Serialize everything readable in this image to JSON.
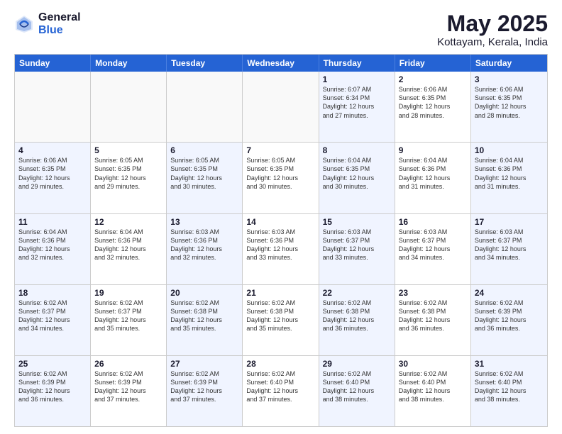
{
  "logo": {
    "general": "General",
    "blue": "Blue"
  },
  "title": "May 2025",
  "location": "Kottayam, Kerala, India",
  "days_of_week": [
    "Sunday",
    "Monday",
    "Tuesday",
    "Wednesday",
    "Thursday",
    "Friday",
    "Saturday"
  ],
  "weeks": [
    [
      {
        "day": "",
        "text": "",
        "empty": true
      },
      {
        "day": "",
        "text": "",
        "empty": true
      },
      {
        "day": "",
        "text": "",
        "empty": true
      },
      {
        "day": "",
        "text": "",
        "empty": true
      },
      {
        "day": "1",
        "text": "Sunrise: 6:07 AM\nSunset: 6:34 PM\nDaylight: 12 hours\nand 27 minutes.",
        "empty": false
      },
      {
        "day": "2",
        "text": "Sunrise: 6:06 AM\nSunset: 6:35 PM\nDaylight: 12 hours\nand 28 minutes.",
        "empty": false
      },
      {
        "day": "3",
        "text": "Sunrise: 6:06 AM\nSunset: 6:35 PM\nDaylight: 12 hours\nand 28 minutes.",
        "empty": false
      }
    ],
    [
      {
        "day": "4",
        "text": "Sunrise: 6:06 AM\nSunset: 6:35 PM\nDaylight: 12 hours\nand 29 minutes.",
        "empty": false
      },
      {
        "day": "5",
        "text": "Sunrise: 6:05 AM\nSunset: 6:35 PM\nDaylight: 12 hours\nand 29 minutes.",
        "empty": false
      },
      {
        "day": "6",
        "text": "Sunrise: 6:05 AM\nSunset: 6:35 PM\nDaylight: 12 hours\nand 30 minutes.",
        "empty": false
      },
      {
        "day": "7",
        "text": "Sunrise: 6:05 AM\nSunset: 6:35 PM\nDaylight: 12 hours\nand 30 minutes.",
        "empty": false
      },
      {
        "day": "8",
        "text": "Sunrise: 6:04 AM\nSunset: 6:35 PM\nDaylight: 12 hours\nand 30 minutes.",
        "empty": false
      },
      {
        "day": "9",
        "text": "Sunrise: 6:04 AM\nSunset: 6:36 PM\nDaylight: 12 hours\nand 31 minutes.",
        "empty": false
      },
      {
        "day": "10",
        "text": "Sunrise: 6:04 AM\nSunset: 6:36 PM\nDaylight: 12 hours\nand 31 minutes.",
        "empty": false
      }
    ],
    [
      {
        "day": "11",
        "text": "Sunrise: 6:04 AM\nSunset: 6:36 PM\nDaylight: 12 hours\nand 32 minutes.",
        "empty": false
      },
      {
        "day": "12",
        "text": "Sunrise: 6:04 AM\nSunset: 6:36 PM\nDaylight: 12 hours\nand 32 minutes.",
        "empty": false
      },
      {
        "day": "13",
        "text": "Sunrise: 6:03 AM\nSunset: 6:36 PM\nDaylight: 12 hours\nand 32 minutes.",
        "empty": false
      },
      {
        "day": "14",
        "text": "Sunrise: 6:03 AM\nSunset: 6:36 PM\nDaylight: 12 hours\nand 33 minutes.",
        "empty": false
      },
      {
        "day": "15",
        "text": "Sunrise: 6:03 AM\nSunset: 6:37 PM\nDaylight: 12 hours\nand 33 minutes.",
        "empty": false
      },
      {
        "day": "16",
        "text": "Sunrise: 6:03 AM\nSunset: 6:37 PM\nDaylight: 12 hours\nand 34 minutes.",
        "empty": false
      },
      {
        "day": "17",
        "text": "Sunrise: 6:03 AM\nSunset: 6:37 PM\nDaylight: 12 hours\nand 34 minutes.",
        "empty": false
      }
    ],
    [
      {
        "day": "18",
        "text": "Sunrise: 6:02 AM\nSunset: 6:37 PM\nDaylight: 12 hours\nand 34 minutes.",
        "empty": false
      },
      {
        "day": "19",
        "text": "Sunrise: 6:02 AM\nSunset: 6:37 PM\nDaylight: 12 hours\nand 35 minutes.",
        "empty": false
      },
      {
        "day": "20",
        "text": "Sunrise: 6:02 AM\nSunset: 6:38 PM\nDaylight: 12 hours\nand 35 minutes.",
        "empty": false
      },
      {
        "day": "21",
        "text": "Sunrise: 6:02 AM\nSunset: 6:38 PM\nDaylight: 12 hours\nand 35 minutes.",
        "empty": false
      },
      {
        "day": "22",
        "text": "Sunrise: 6:02 AM\nSunset: 6:38 PM\nDaylight: 12 hours\nand 36 minutes.",
        "empty": false
      },
      {
        "day": "23",
        "text": "Sunrise: 6:02 AM\nSunset: 6:38 PM\nDaylight: 12 hours\nand 36 minutes.",
        "empty": false
      },
      {
        "day": "24",
        "text": "Sunrise: 6:02 AM\nSunset: 6:39 PM\nDaylight: 12 hours\nand 36 minutes.",
        "empty": false
      }
    ],
    [
      {
        "day": "25",
        "text": "Sunrise: 6:02 AM\nSunset: 6:39 PM\nDaylight: 12 hours\nand 36 minutes.",
        "empty": false
      },
      {
        "day": "26",
        "text": "Sunrise: 6:02 AM\nSunset: 6:39 PM\nDaylight: 12 hours\nand 37 minutes.",
        "empty": false
      },
      {
        "day": "27",
        "text": "Sunrise: 6:02 AM\nSunset: 6:39 PM\nDaylight: 12 hours\nand 37 minutes.",
        "empty": false
      },
      {
        "day": "28",
        "text": "Sunrise: 6:02 AM\nSunset: 6:40 PM\nDaylight: 12 hours\nand 37 minutes.",
        "empty": false
      },
      {
        "day": "29",
        "text": "Sunrise: 6:02 AM\nSunset: 6:40 PM\nDaylight: 12 hours\nand 38 minutes.",
        "empty": false
      },
      {
        "day": "30",
        "text": "Sunrise: 6:02 AM\nSunset: 6:40 PM\nDaylight: 12 hours\nand 38 minutes.",
        "empty": false
      },
      {
        "day": "31",
        "text": "Sunrise: 6:02 AM\nSunset: 6:40 PM\nDaylight: 12 hours\nand 38 minutes.",
        "empty": false
      }
    ]
  ]
}
